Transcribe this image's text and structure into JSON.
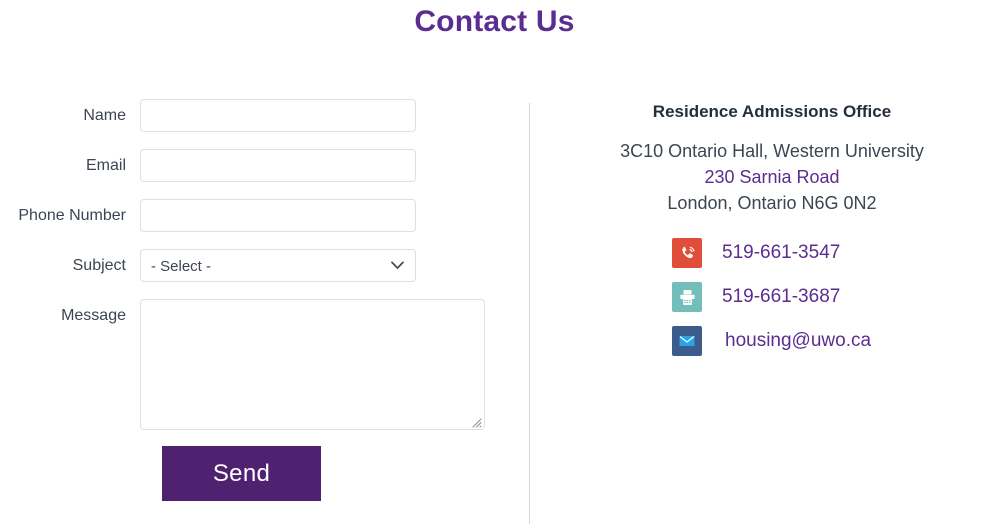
{
  "page": {
    "title": "Contact Us",
    "title_color": "#5b2d90"
  },
  "form": {
    "fields": [
      {
        "label": "Name",
        "type": "text",
        "value": "",
        "placeholder": ""
      },
      {
        "label": "Email",
        "type": "text",
        "value": "",
        "placeholder": ""
      },
      {
        "label": "Phone Number",
        "type": "text",
        "value": "",
        "placeholder": ""
      },
      {
        "label": "Subject",
        "type": "select",
        "value": "- Select -",
        "placeholder": ""
      },
      {
        "label": "Message",
        "type": "textarea",
        "value": "",
        "placeholder": ""
      }
    ],
    "name_label": "Name",
    "email_label": "Email",
    "phone_label": "Phone Number",
    "subject_label": "Subject",
    "message_label": "Message",
    "name_value": "",
    "email_value": "",
    "phone_value": "",
    "message_value": "",
    "subject_selected": "- Select -",
    "subject_options": [
      "- Select -"
    ],
    "chevron_icon": "chevron-down-icon",
    "resize_icon": "resize-grip-icon",
    "submit_label": "Send",
    "submit_color": "#4f2170"
  },
  "info": {
    "heading": "Residence Admissions Office",
    "address_line1": "3C10 Ontario Hall, Western University",
    "address_line2": "230 Sarnia Road",
    "address_line3": "London, Ontario  N6G 0N2",
    "address_link_color": "#5b2d90",
    "contacts": [
      {
        "icon": "phone-icon",
        "icon_color": "#e04e39",
        "value": "519-661-3547"
      },
      {
        "icon": "fax-icon",
        "icon_color": "#73bdbb",
        "value": "519-661-3687"
      },
      {
        "icon": "email-icon",
        "icon_color": "#3c5c8c",
        "value": "housing@uwo.ca"
      }
    ],
    "phone_value": "519-661-3547",
    "fax_value": "519-661-3687",
    "email_value": "housing@uwo.ca"
  }
}
